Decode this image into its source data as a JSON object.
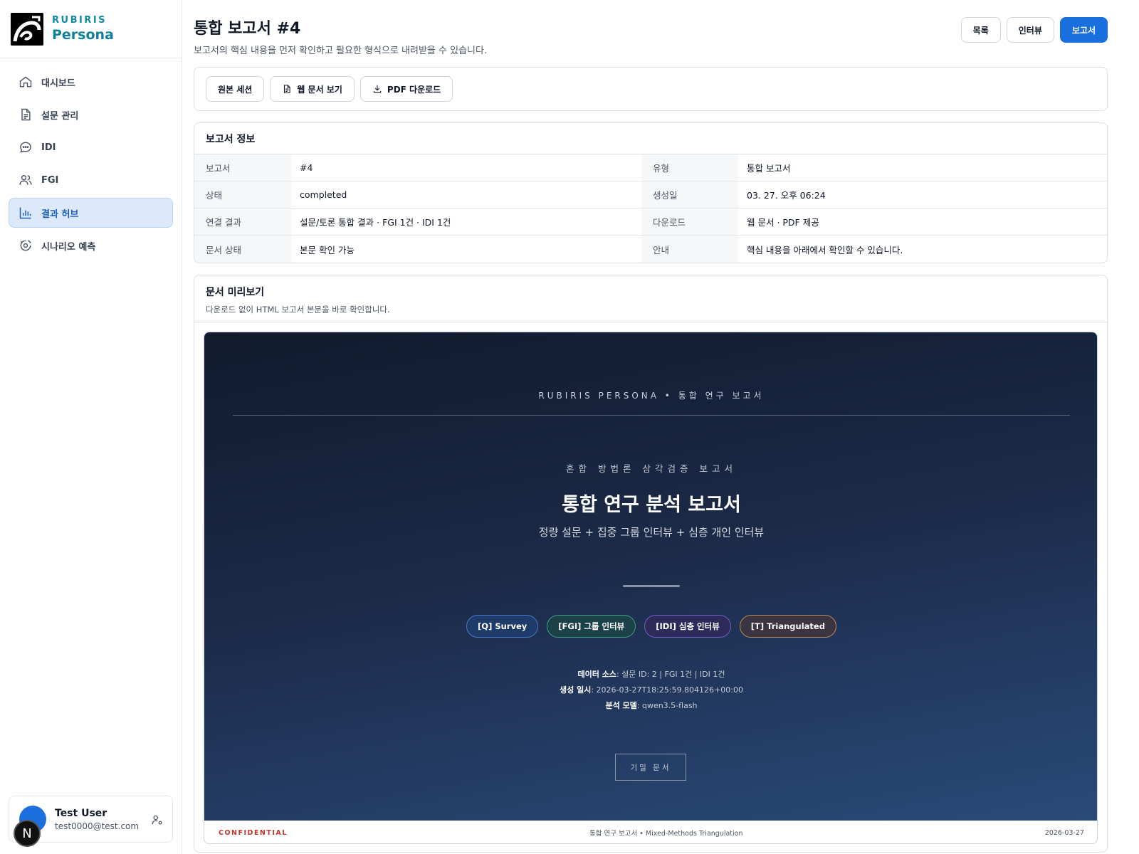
{
  "brand": {
    "top": "RUBIRIS",
    "name": "Persona"
  },
  "nav": [
    {
      "label": "대시보드",
      "icon": "home-icon"
    },
    {
      "label": "설문 관리",
      "icon": "document-icon"
    },
    {
      "label": "IDI",
      "icon": "chat-icon"
    },
    {
      "label": "FGI",
      "icon": "users-icon"
    },
    {
      "label": "결과 허브",
      "icon": "bar-chart-icon",
      "active": true
    },
    {
      "label": "시나리오 예측",
      "icon": "scenario-icon"
    }
  ],
  "user": {
    "name": "Test User",
    "email": "test0000@test.com",
    "badge": "N"
  },
  "header": {
    "title": "통합 보고서 #4",
    "subtitle": "보고서의 핵심 내용을 먼저 확인하고 필요한 형식으로 내려받을 수 있습니다.",
    "actions": {
      "list": "목록",
      "interview": "인터뷰",
      "report": "보고서"
    }
  },
  "toolbar": {
    "source_session": "원본 세션",
    "web_view": "웹 문서 보기",
    "pdf_download": "PDF 다운로드"
  },
  "report_info": {
    "title": "보고서 정보",
    "rows": [
      {
        "k1": "보고서",
        "v1": "#4",
        "k2": "유형",
        "v2": "통합 보고서"
      },
      {
        "k1": "상태",
        "v1": "completed",
        "k2": "생성일",
        "v2": "03. 27. 오후 06:24"
      },
      {
        "k1": "연결 결과",
        "v1": "설문/토론 통합 결과 · FGI 1건 · IDI 1건",
        "k2": "다운로드",
        "v2": "웹 문서 · PDF 제공"
      },
      {
        "k1": "문서 상태",
        "v1": "본문 확인 가능",
        "k2": "안내",
        "v2": "핵심 내용을 아래에서 확인할 수 있습니다."
      }
    ]
  },
  "preview": {
    "title": "문서 미리보기",
    "subtitle": "다운로드 없이 HTML 보고서 본문을 바로 확인합니다."
  },
  "document": {
    "kicker": "RUBIRIS PERSONA • 통합 연구 보고서",
    "eyebrow": "혼합 방법론 삼각검증 보고서",
    "title": "통합 연구 분석 보고서",
    "subtitle": "정량 설문 + 집중 그룹 인터뷰 + 심층 개인 인터뷰",
    "chips": {
      "q": "[Q] Survey",
      "fgi": "[FGI] 그룹 인터뷰",
      "idi": "[IDI] 심층 인터뷰",
      "t": "[T] Triangulated"
    },
    "meta": {
      "source_label": "데이터 소스",
      "source_value": ": 설문 ID: 2 | FGI 1건 | IDI 1건",
      "created_label": "생성 일시",
      "created_value": ": 2026-03-27T18:25:59.804126+00:00",
      "model_label": "분석 모델",
      "model_value": ": qwen3.5-flash"
    },
    "stamp": "기밀 문서",
    "footer": {
      "left": "CONFIDENTIAL",
      "center": "통합 연구 보고서 • Mixed-Methods Triangulation",
      "right": "2026-03-27"
    }
  },
  "colors": {
    "accent": "#1a6fdf",
    "brand": "#0f7f9a",
    "active_nav_bg": "#dbe9fb",
    "confidential": "#c0362c"
  }
}
